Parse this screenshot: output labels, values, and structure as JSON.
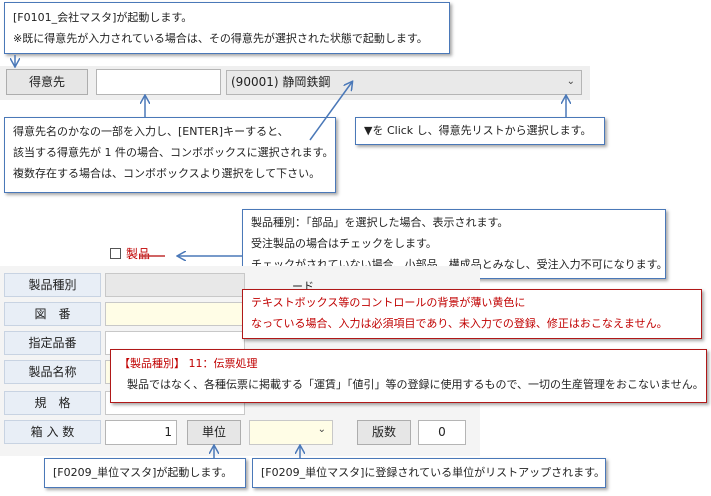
{
  "callouts": {
    "top": [
      "[F0101_会社マスタ]が起動します。",
      "※既に得意先が入力されている場合は、その得意先が選択された状態で起動します。"
    ],
    "customer_name": [
      "得意先名のかなの一部を入力し、[ENTER]キーすると、",
      "該当する得意先が 1 件の場合、コンボボックスに選択されます。",
      "複数存在する場合は、コンボボックスより選択をして下さい。"
    ],
    "dropdown": "▼を Click し、得意先リストから選択します。",
    "product_type": [
      "製品種別：「部品」を選択した場合、表示されます。",
      "受注製品の場合はチェックをします。",
      "チェックがされていない場合、小部品、構成品とみなし、受注入力不可になります。"
    ],
    "yellow_note": [
      "テキストボックス等のコントロールの背景が薄い黄色に",
      "なっている場合、入力は必須項目であり、未入力での登録、修正はおこなえません。"
    ],
    "slip_title": "【製品種別】 11：伝票処理",
    "slip_body": "製品ではなく、各種伝票に掲載する「運賃」「値引」等の登録に使用するもので、一切の生産管理をおこないません。",
    "unit_master": "[F0209_単位マスタ]が起動します。",
    "unit_list": "[F0209_単位マスタ]に登録されている単位がリストアップされます。"
  },
  "customer": {
    "button_label": "得意先",
    "search_value": "",
    "combo_value": "(90001) 静岡鉄鋼"
  },
  "form": {
    "product_checkbox_label": "製品",
    "product_checked": false,
    "labels": {
      "product_type": "製品種別",
      "drawing_no": "図　番",
      "designated_no": "指定品番",
      "product_name": "製品名称",
      "spec": "規　格",
      "quantity": "箱 入 数"
    },
    "partial_code_label": "ード",
    "quantity_value": "1",
    "unit_button_label": "単位",
    "unit_value": "",
    "version_label": "版数",
    "version_value": "0"
  },
  "colors": {
    "callout_border": "#4a78b8",
    "warning_border": "#b01818",
    "warning_text": "#c00000",
    "required_field_bg": "#fffde6"
  }
}
